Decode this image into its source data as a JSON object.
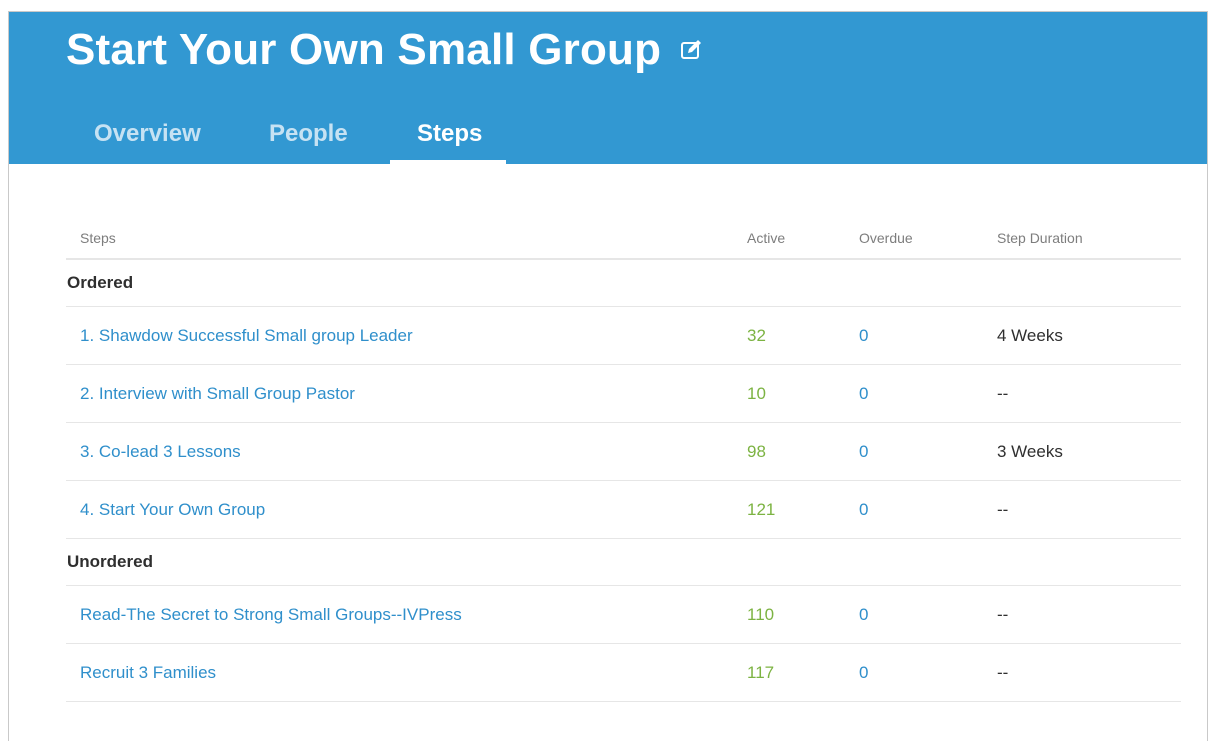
{
  "header": {
    "title": "Start Your Own Small Group",
    "edit_icon": "edit-icon",
    "accent_color": "#3298d2",
    "tabs": [
      {
        "label": "Overview",
        "selected": false
      },
      {
        "label": "People",
        "selected": false
      },
      {
        "label": "Steps",
        "selected": true
      }
    ]
  },
  "table": {
    "headers": {
      "steps": "Steps",
      "active": "Active",
      "overdue": "Overdue",
      "duration": "Step Duration"
    },
    "groups": [
      {
        "label": "Ordered",
        "rows": [
          {
            "step": "1. Shawdow Successful Small group Leader",
            "active": "32",
            "overdue": "0",
            "duration": "4 Weeks"
          },
          {
            "step": "2. Interview with Small Group Pastor",
            "active": "10",
            "overdue": "0",
            "duration": "--"
          },
          {
            "step": "3. Co-lead 3 Lessons",
            "active": "98",
            "overdue": "0",
            "duration": "3 Weeks"
          },
          {
            "step": "4. Start Your Own Group",
            "active": "121",
            "overdue": "0",
            "duration": "--"
          }
        ]
      },
      {
        "label": "Unordered",
        "rows": [
          {
            "step": "Read-The Secret to Strong Small Groups--IVPress",
            "active": "110",
            "overdue": "0",
            "duration": "--"
          },
          {
            "step": "Recruit 3 Families",
            "active": "117",
            "overdue": "0",
            "duration": "--"
          }
        ]
      }
    ]
  },
  "colors": {
    "link": "#2f8fcb",
    "active_value": "#7cb342",
    "text": "#2f2f2f"
  }
}
